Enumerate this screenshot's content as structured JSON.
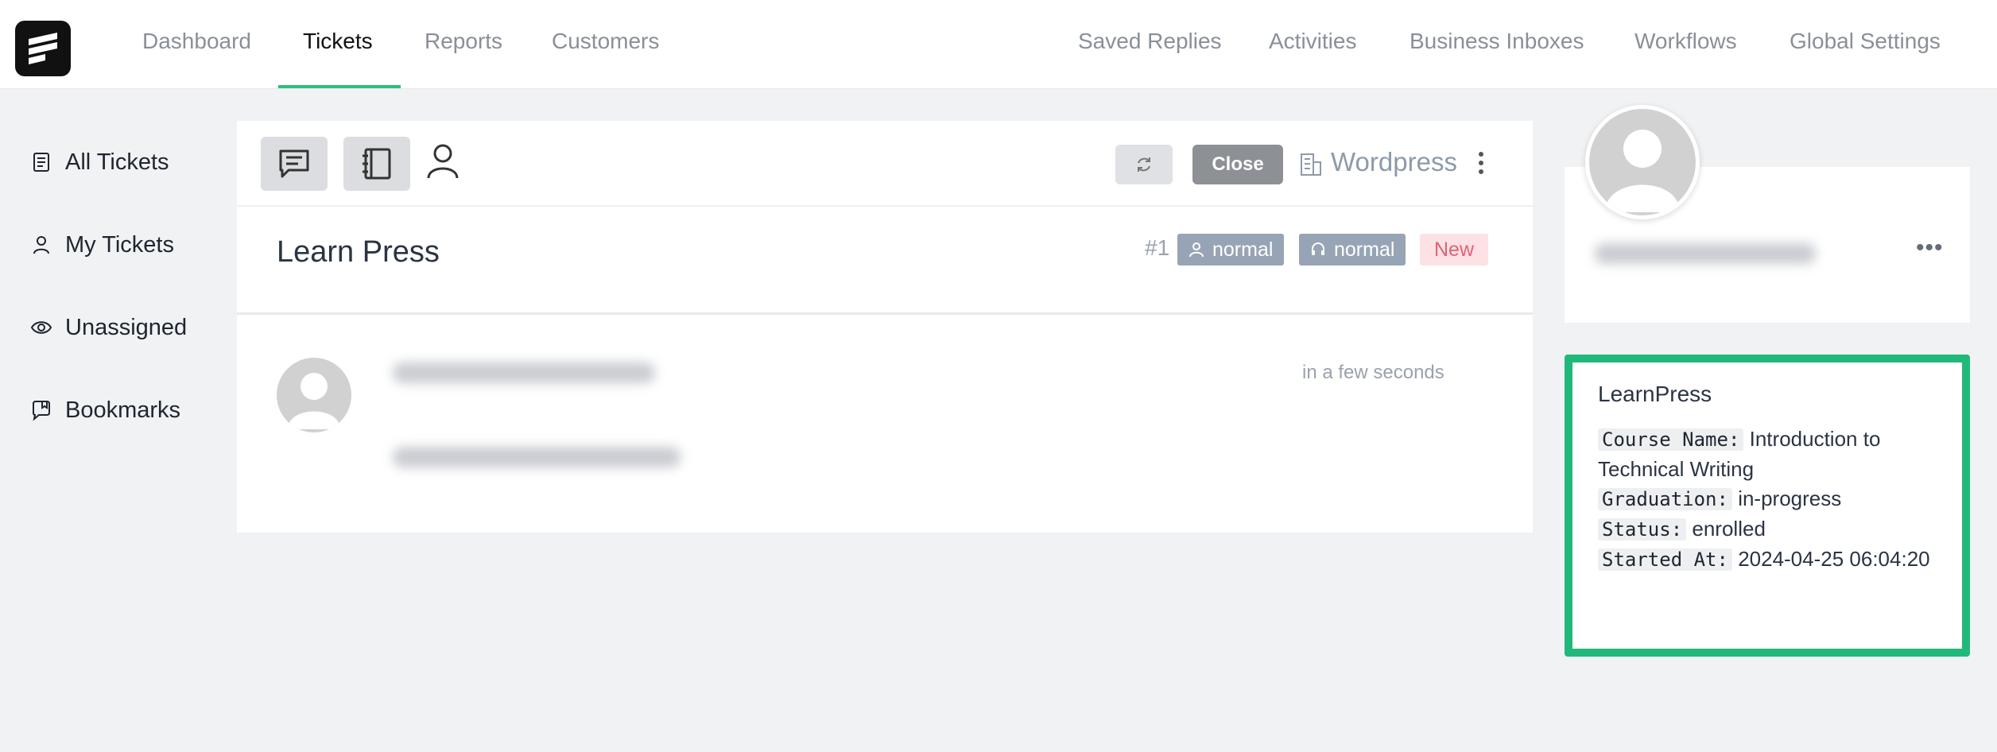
{
  "nav": {
    "left": [
      {
        "label": "Dashboard"
      },
      {
        "label": "Tickets",
        "active": true
      },
      {
        "label": "Reports"
      },
      {
        "label": "Customers"
      }
    ],
    "right": [
      {
        "label": "Saved Replies"
      },
      {
        "label": "Activities"
      },
      {
        "label": "Business Inboxes"
      },
      {
        "label": "Workflows"
      },
      {
        "label": "Global Settings"
      }
    ],
    "active_underline_color": "#2fbf7e"
  },
  "sidebar": {
    "items": [
      {
        "label": "All Tickets",
        "icon": "document-icon"
      },
      {
        "label": "My Tickets",
        "icon": "user-icon"
      },
      {
        "label": "Unassigned",
        "icon": "eye-icon"
      },
      {
        "label": "Bookmarks",
        "icon": "bookmark-chat-icon"
      }
    ]
  },
  "ticket": {
    "toolbar": {
      "close_label": "Close",
      "inbox_name": "Wordpress"
    },
    "title": "Learn Press",
    "number": "#1",
    "badges": {
      "customer_priority": "normal",
      "agent_priority": "normal",
      "status": "New"
    },
    "message": {
      "time": "in a few seconds"
    }
  },
  "learnpress": {
    "title": "LearnPress",
    "fields": [
      {
        "key": "Course Name:",
        "value": "Introduction to Technical Writing"
      },
      {
        "key": "Graduation:",
        "value": "in-progress"
      },
      {
        "key": "Status:",
        "value": "enrolled"
      },
      {
        "key": "Started At:",
        "value": "2024-04-25 06:04:20"
      }
    ],
    "highlight_color": "#20b97b"
  },
  "profile": {
    "more_label": "•••"
  }
}
